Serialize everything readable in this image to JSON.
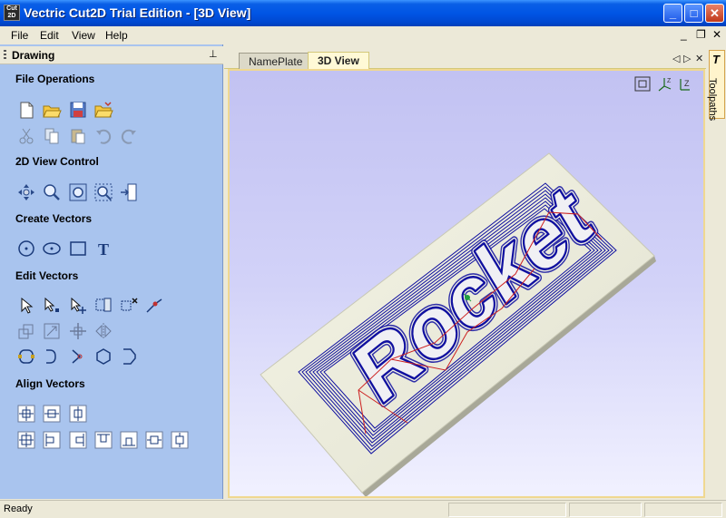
{
  "window": {
    "app_icon_text": "Cut 2D",
    "title": "Vectric Cut2D Trial Edition - [3D View]",
    "minimize": "_",
    "maximize": "□",
    "close": "✕"
  },
  "menu": {
    "items": [
      "File",
      "Edit",
      "View",
      "Help"
    ],
    "mdi_controls": [
      "_",
      "❐",
      "✕"
    ]
  },
  "drawing_panel": {
    "title": "Drawing",
    "pin": "⊥",
    "sections": {
      "file_operations": "File Operations",
      "view_control": "2D View Control",
      "create_vectors": "Create Vectors",
      "edit_vectors": "Edit Vectors",
      "align_vectors": "Align Vectors"
    },
    "text_tool_glyph": "T"
  },
  "tabs": {
    "items": [
      "NamePlate",
      "3D View"
    ],
    "active": "3D View",
    "controls": [
      "◁",
      "▷",
      "✕"
    ]
  },
  "viewport": {
    "axis_labels": [
      "X",
      "Y",
      "Z"
    ],
    "engraved_text": "Rocket"
  },
  "right_panel": {
    "label": "Toolpaths",
    "icon_glyph": "T"
  },
  "status": {
    "text": "Ready"
  },
  "colors": {
    "title_bar": "#0055e5",
    "panel_bg": "#a9c4ee",
    "viewport_top": "#c2c2f2",
    "toolpath_blue": "#1010a0",
    "toolpath_red": "#cc2020",
    "plate": "#e8e8d8"
  }
}
